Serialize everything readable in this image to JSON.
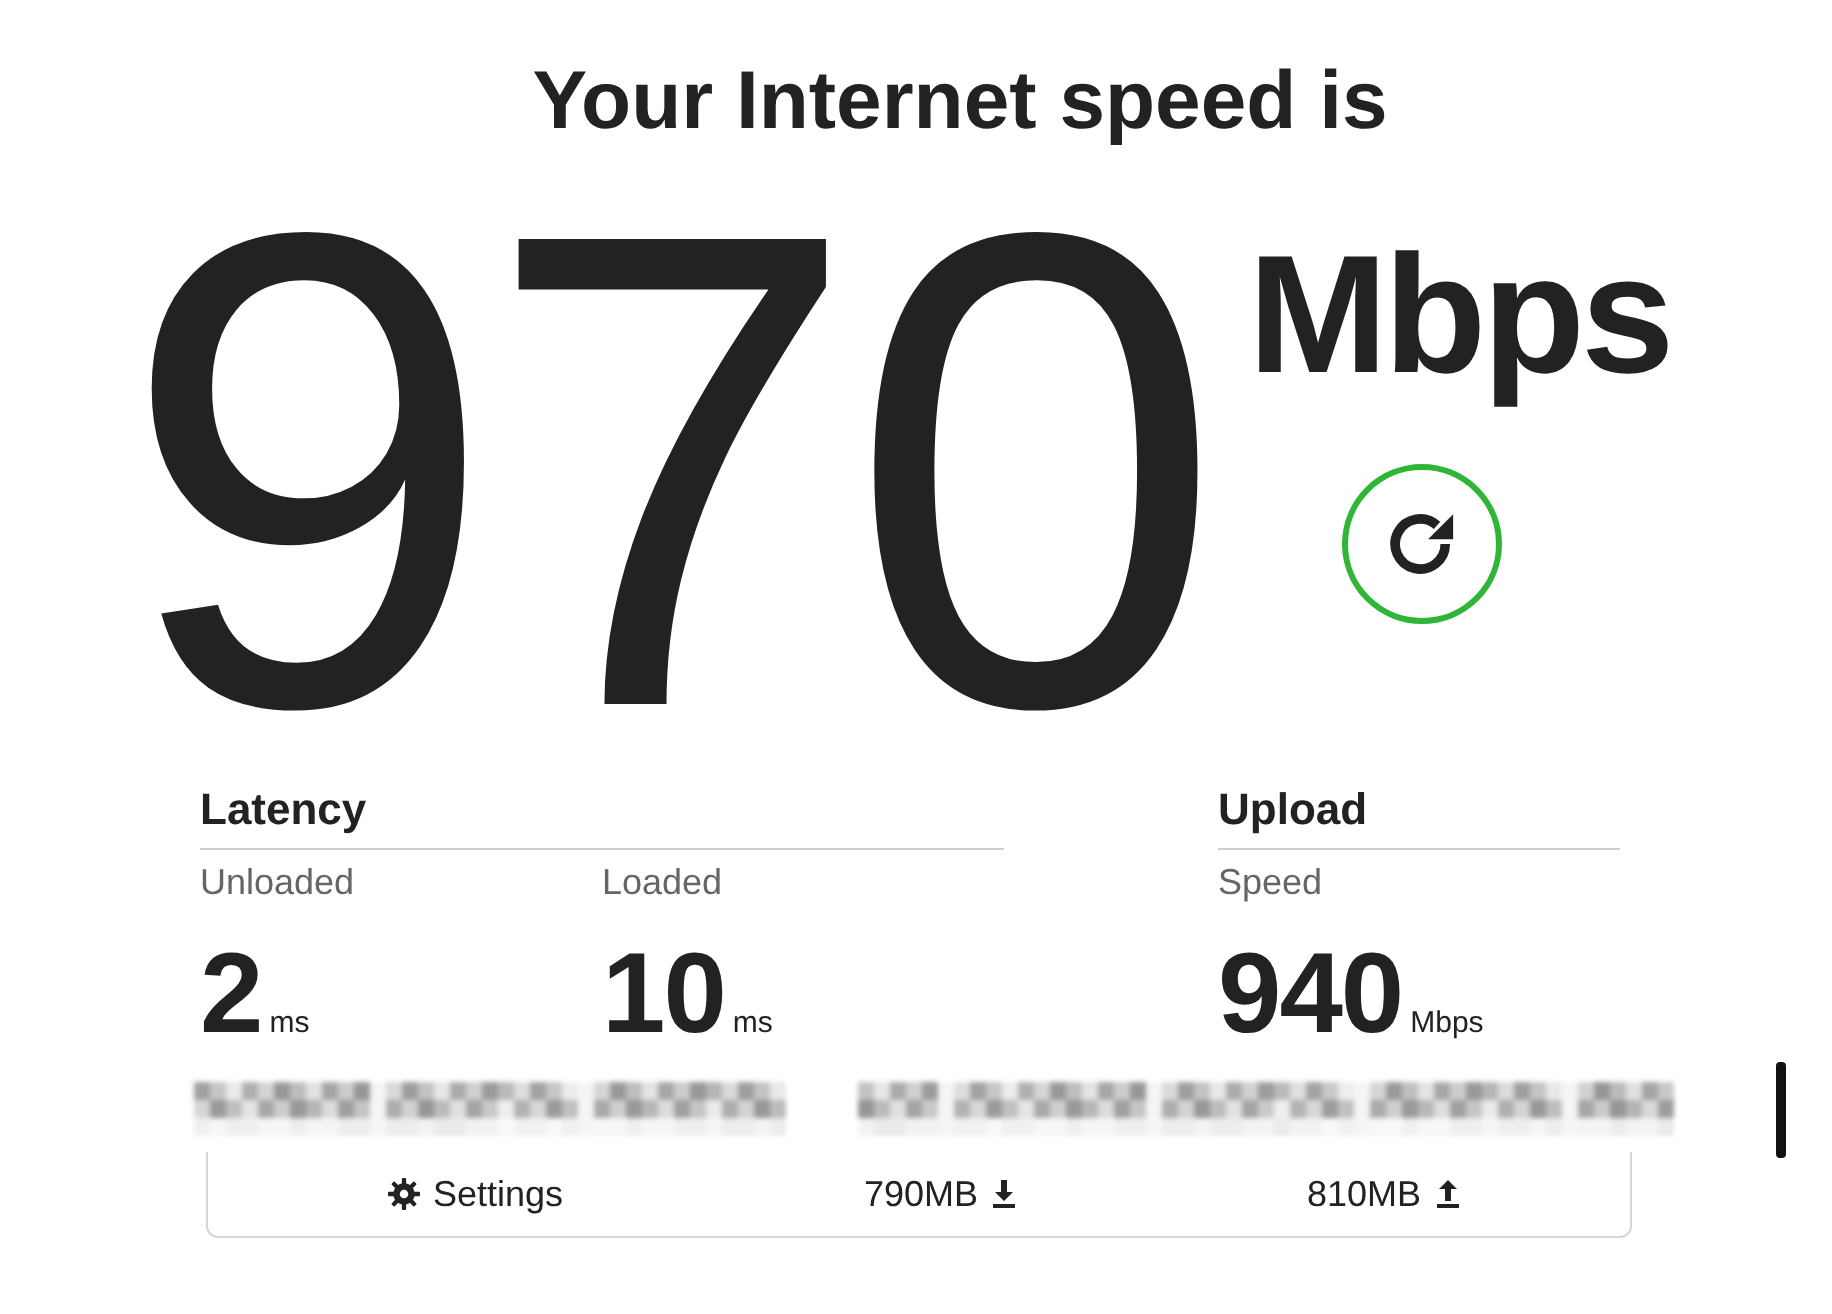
{
  "heading": "Your Internet speed is",
  "speed": {
    "value": "970",
    "unit": "Mbps"
  },
  "sections": [
    {
      "title": "Latency",
      "metrics": [
        {
          "label": "Unloaded",
          "value": "2",
          "unit": "ms"
        },
        {
          "label": "Loaded",
          "value": "10",
          "unit": "ms"
        }
      ]
    },
    {
      "title": "Upload",
      "metrics": [
        {
          "label": "Speed",
          "value": "940",
          "unit": "Mbps"
        }
      ]
    }
  ],
  "footer": [
    {
      "kind": "settings",
      "label": "Settings"
    },
    {
      "kind": "download",
      "label": "790MB"
    },
    {
      "kind": "upload",
      "label": "810MB"
    }
  ]
}
